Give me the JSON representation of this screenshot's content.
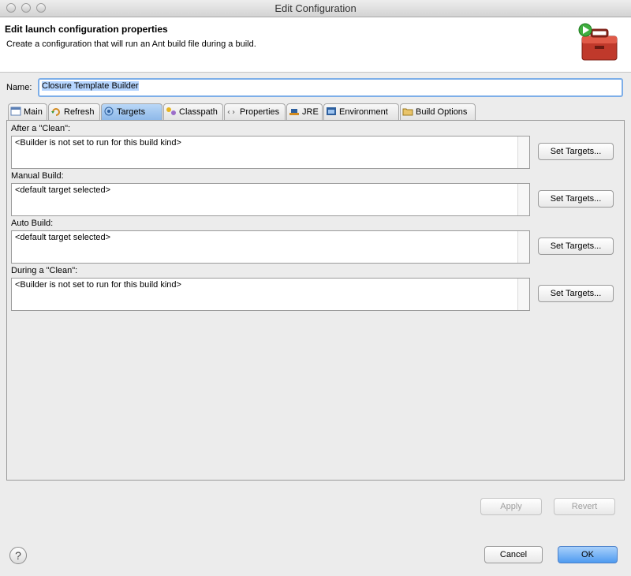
{
  "window": {
    "title": "Edit Configuration"
  },
  "header": {
    "title": "Edit launch configuration properties",
    "description": "Create a configuration that will run an Ant build file during a build."
  },
  "name_field": {
    "label": "Name:",
    "value": "Closure Template Builder"
  },
  "tabs": [
    {
      "label": "Main",
      "icon": "main-tab-icon"
    },
    {
      "label": "Refresh",
      "icon": "refresh-icon"
    },
    {
      "label": "Targets",
      "icon": "targets-icon",
      "selected": true
    },
    {
      "label": "Classpath",
      "icon": "classpath-icon"
    },
    {
      "label": "Properties",
      "icon": "properties-icon"
    },
    {
      "label": "JRE",
      "icon": "jre-icon"
    },
    {
      "label": "Environment",
      "icon": "environment-icon"
    },
    {
      "label": "Build Options",
      "icon": "folder-icon"
    }
  ],
  "sections": [
    {
      "label": "After a \"Clean\":",
      "value": "<Builder is not set to run for this build kind>",
      "button": "Set Targets..."
    },
    {
      "label": "Manual Build:",
      "value": "<default target selected>",
      "button": "Set Targets..."
    },
    {
      "label": "Auto Build:",
      "value": "<default target selected>",
      "button": "Set Targets..."
    },
    {
      "label": "During a \"Clean\":",
      "value": "<Builder is not set to run for this build kind>",
      "button": "Set Targets..."
    }
  ],
  "panel_buttons": {
    "apply": "Apply",
    "revert": "Revert"
  },
  "footer": {
    "help": "?",
    "cancel": "Cancel",
    "ok": "OK"
  },
  "colors": {
    "accent": "#4f9bf0",
    "selection": "#b5d5ff",
    "close": "#e0443e",
    "toolbox": "#c0392b"
  }
}
